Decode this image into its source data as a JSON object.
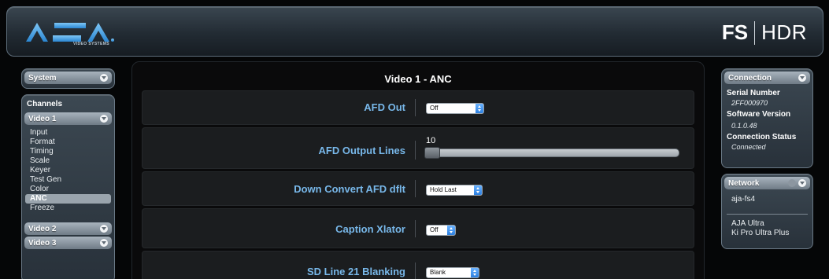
{
  "header": {
    "logo": "AJA",
    "logo_sub": "VIDEO SYSTEMS",
    "product_bold": "FS",
    "product_light": "HDR"
  },
  "left": {
    "system": "System",
    "channels": "Channels",
    "video1": "Video 1",
    "video1_items": [
      "Input",
      "Format",
      "Timing",
      "Scale",
      "Keyer",
      "Test Gen",
      "Color",
      "ANC",
      "Freeze"
    ],
    "active_item": "ANC",
    "video2": "Video 2",
    "video3": "Video 3"
  },
  "main": {
    "title": "Video 1 - ANC",
    "afd_out_label": "AFD Out",
    "afd_out_value": "Off",
    "afd_lines_label": "AFD Output Lines",
    "afd_lines_value": "10",
    "afd_lines_level": 0,
    "down_convert_label": "Down Convert AFD dflt",
    "down_convert_value": "Hold Last",
    "caption_label": "Caption Xlator",
    "caption_value": "Off",
    "sd_line_label": "SD Line 21 Blanking",
    "sd_line_value": "Blank"
  },
  "right": {
    "connection": "Connection",
    "serial_label": "Serial Number",
    "serial_value": "2FF000970",
    "software_label": "Software Version",
    "software_value": "0.1.0.48",
    "status_label": "Connection Status",
    "status_value": "Connected",
    "network": "Network",
    "net1": "aja-fs4",
    "net2": "AJA Ultra",
    "net3": "Ki Pro Ultra Plus"
  }
}
